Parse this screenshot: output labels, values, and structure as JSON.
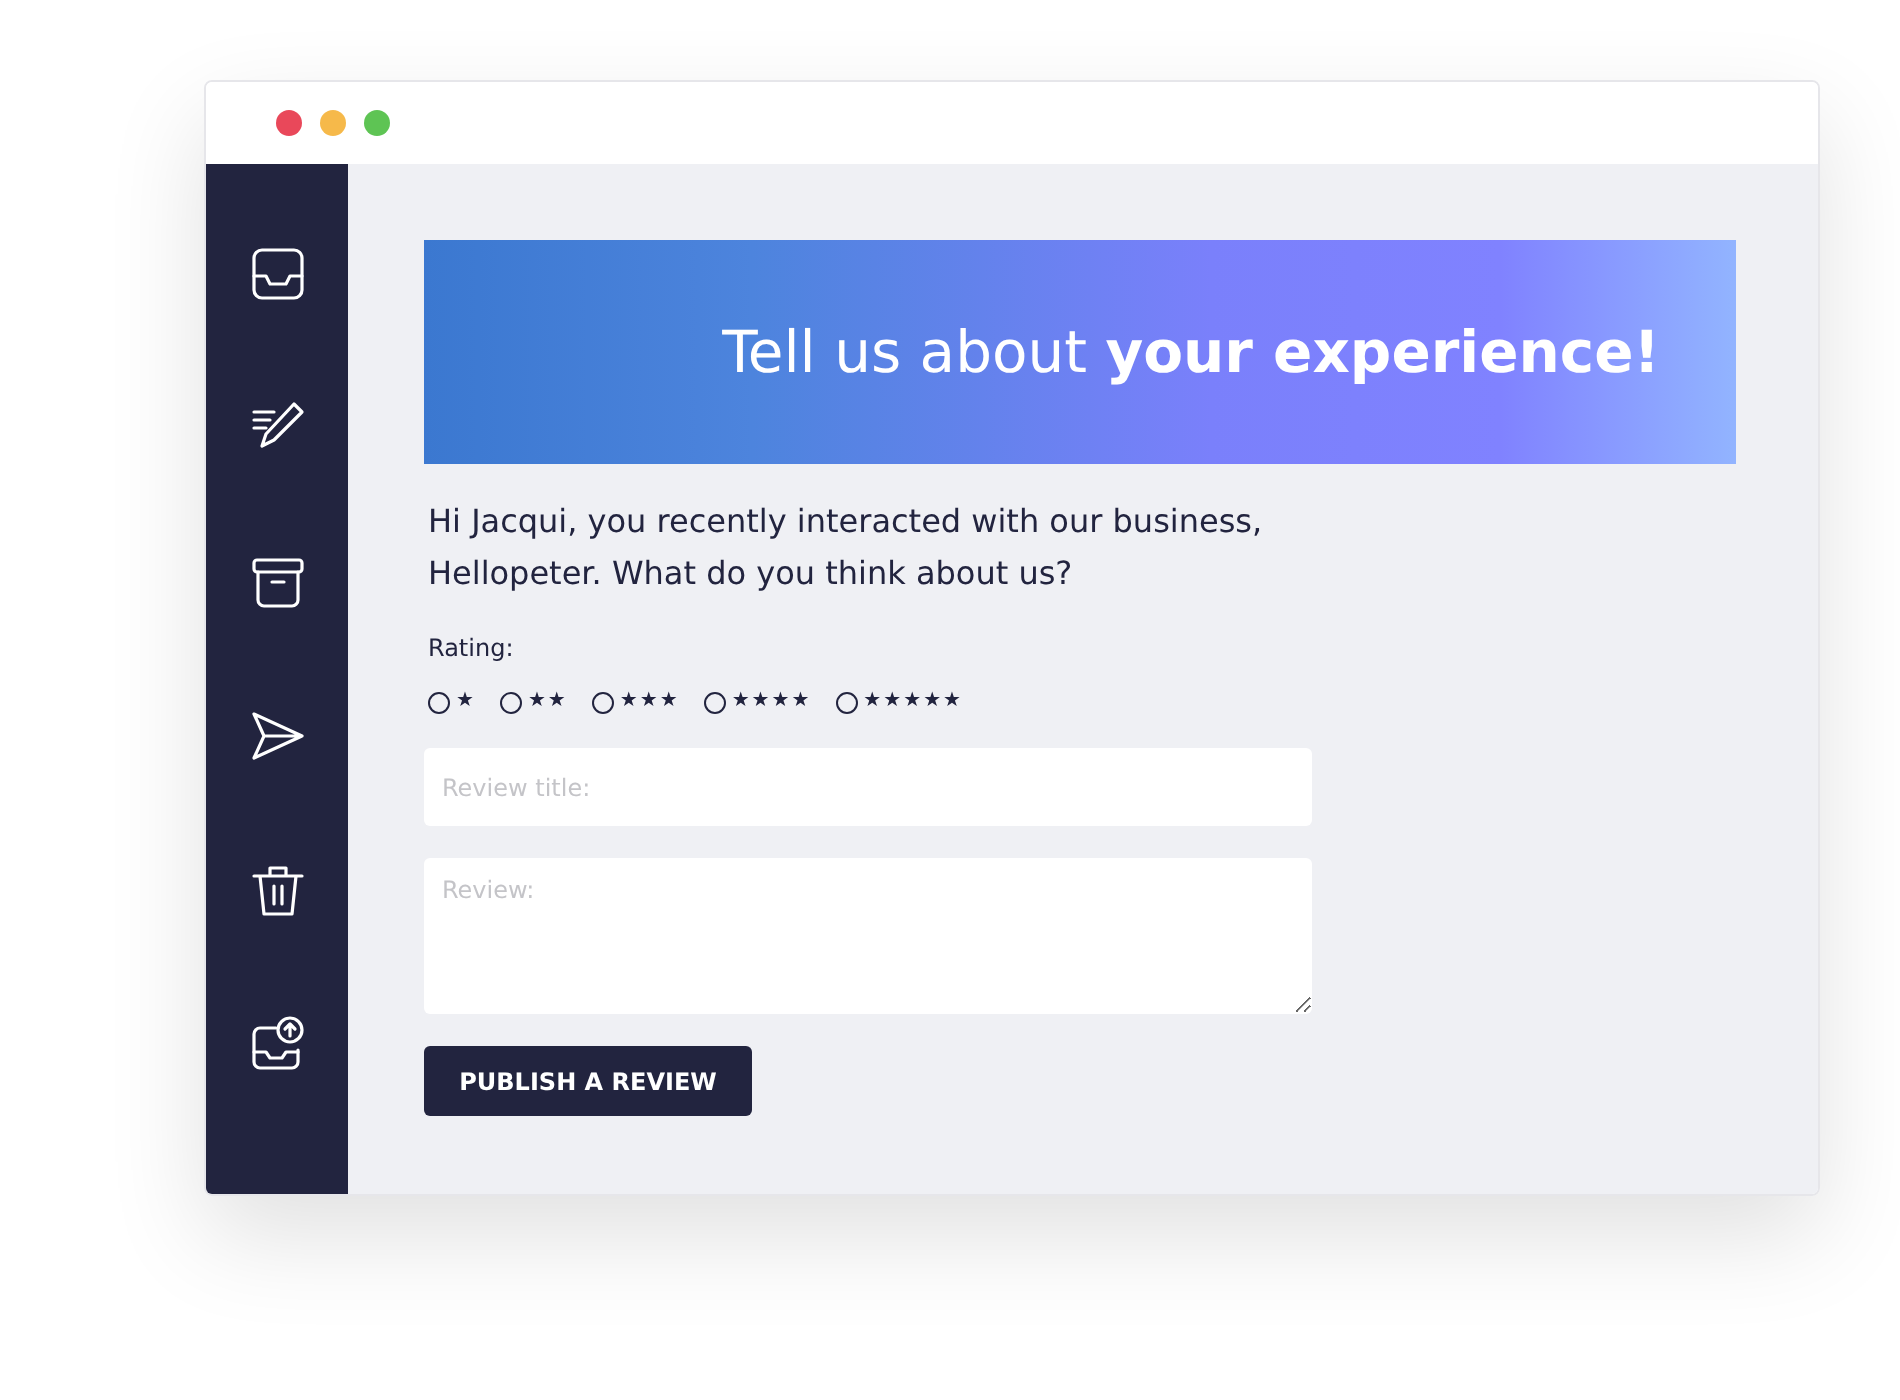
{
  "window": {
    "controls": [
      {
        "color": "#e9485a"
      },
      {
        "color": "#f6b94a"
      },
      {
        "color": "#5ec454"
      }
    ]
  },
  "sidebar": {
    "items": [
      {
        "kind": "inbox"
      },
      {
        "kind": "compose"
      },
      {
        "kind": "archive"
      },
      {
        "kind": "send"
      },
      {
        "kind": "trash"
      },
      {
        "kind": "upload"
      }
    ]
  },
  "banner": {
    "title": "Tell us about **your experience!**"
  },
  "intro": "Hi Jacqui, you recently interacted with our business, Hellopeter. What do you think about us?",
  "rating": {
    "label": "Rating:",
    "options": [
      {
        "selected": false,
        "label": "★"
      },
      {
        "selected": false,
        "label": "★★"
      },
      {
        "selected": false,
        "label": "★★★"
      },
      {
        "selected": false,
        "label": "★★★★"
      },
      {
        "selected": false,
        "label": "★★★★★"
      }
    ]
  },
  "title_field": {
    "placeholder": "Review title:"
  },
  "review_field": {
    "placeholder": "Review:"
  },
  "submit": {
    "label": "PUBLISH A REVIEW"
  }
}
